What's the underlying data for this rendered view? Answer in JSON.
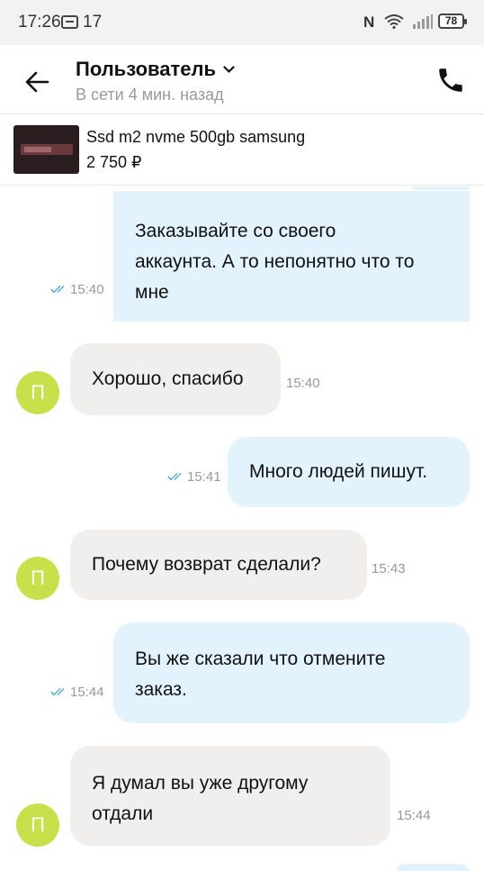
{
  "status_bar": {
    "time": "17:26",
    "notification_count": "17",
    "nfc": "N",
    "battery": "78"
  },
  "header": {
    "title": "Пользователь",
    "subtitle": "В сети 4 мин. назад"
  },
  "product": {
    "name": "Ssd m2 nvme 500gb samsung",
    "price": "2 750 ₽"
  },
  "messages": [
    {
      "direction": "out",
      "lines": [
        "Заказывайте со своего",
        "аккаунта. А то непонятно что то",
        "мне"
      ],
      "time": "15:40",
      "read": true
    },
    {
      "direction": "in",
      "avatar": "П",
      "lines": [
        "Хорошо, спасибо"
      ],
      "time": "15:40"
    },
    {
      "direction": "out",
      "lines": [
        "Много людей пишут."
      ],
      "time": "15:41",
      "read": true
    },
    {
      "direction": "in",
      "avatar": "П",
      "lines": [
        "Почему возврат сделали?"
      ],
      "time": "15:43"
    },
    {
      "direction": "out",
      "lines": [
        "Вы же сказали что отмените",
        "заказ."
      ],
      "time": "15:44",
      "read": true
    },
    {
      "direction": "in",
      "avatar": "П",
      "lines": [
        "Я думал вы уже другому",
        "отдали"
      ],
      "time": "15:44"
    }
  ],
  "colors": {
    "outgoing_bubble": "#e3f3fd",
    "incoming_bubble": "#f0efee",
    "avatar": "#c8e04a",
    "read_ticks": "#4aa8e0"
  }
}
